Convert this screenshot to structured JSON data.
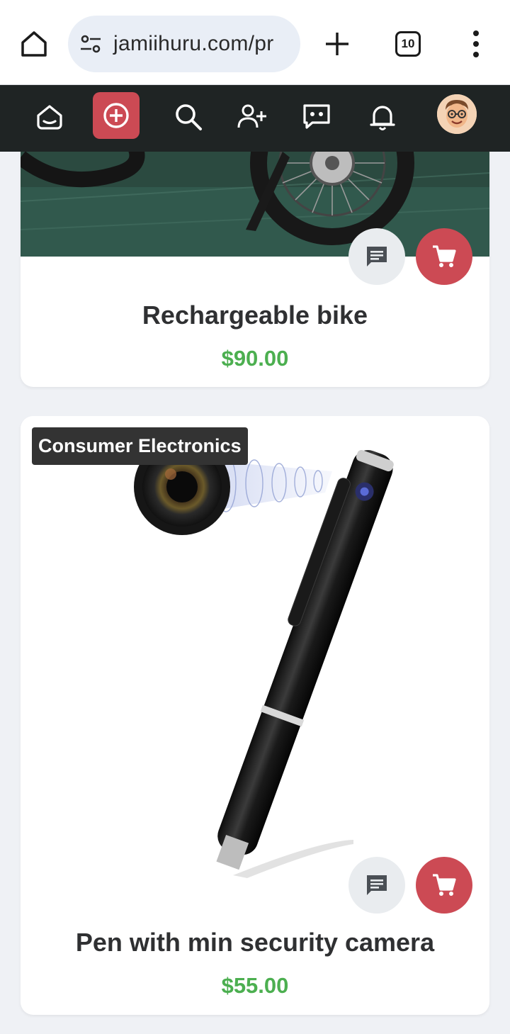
{
  "browser": {
    "url": "jamiihuru.com/pr",
    "tab_count": "10"
  },
  "nav": {
    "items": [
      "home-icon",
      "add-post-icon",
      "search-icon",
      "add-friend-icon",
      "messages-icon",
      "notifications-icon",
      "avatar"
    ]
  },
  "products": [
    {
      "title": "Rechargeable bike",
      "price": "$90.00",
      "image": "electric fat-tire bike on green floor"
    },
    {
      "category": "Consumer Electronics",
      "title": "Pen with min security camera",
      "price": "$55.00",
      "image": "black pen with camera lens"
    }
  ],
  "colors": {
    "accent": "#cc4a54",
    "nav_bg": "#1f2424",
    "price": "#4caf50",
    "page_bg": "#eff1f5"
  }
}
